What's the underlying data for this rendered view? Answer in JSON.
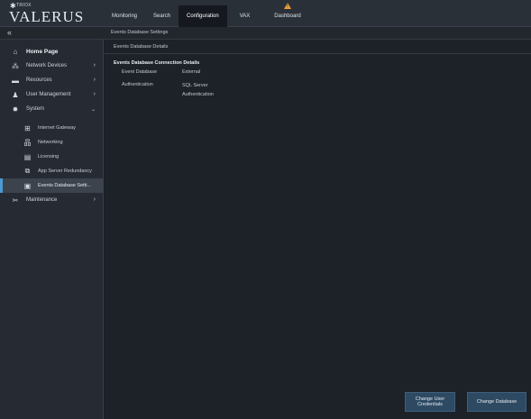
{
  "header": {
    "brand_small": "TRIOX",
    "brand": "VALERUS",
    "nav": [
      {
        "label": "Monitoring",
        "active": false
      },
      {
        "label": "Search",
        "active": false
      },
      {
        "label": "Configuration",
        "active": true
      },
      {
        "label": "VAX",
        "active": false
      },
      {
        "label": "Dashboard",
        "active": false,
        "icon": "warning-icon"
      }
    ]
  },
  "subbar": {
    "collapse_icon": "«",
    "breadcrumb": "Events Database Settings"
  },
  "sidebar": {
    "items": [
      {
        "label": "Home Page",
        "icon": "home-icon"
      },
      {
        "label": "Network Devices",
        "icon": "network-devices-icon"
      },
      {
        "label": "Resources",
        "icon": "resources-icon"
      },
      {
        "label": "User Management",
        "icon": "user-management-icon"
      },
      {
        "label": "System",
        "icon": "gear-icon"
      },
      {
        "label": "Maintenance",
        "icon": "tools-icon"
      }
    ],
    "system_children": [
      {
        "label": "Internet Gateway",
        "icon": "gateway-icon"
      },
      {
        "label": "Networking",
        "icon": "networking-icon"
      },
      {
        "label": "Licensing",
        "icon": "license-icon"
      },
      {
        "label": "App Server Redundancy",
        "icon": "redundancy-icon"
      },
      {
        "label": "Events Database Setti...",
        "icon": "database-settings-icon",
        "active": true
      }
    ]
  },
  "main": {
    "panel_title": "Events Database Details",
    "section_title": "Events Database Connection Details",
    "rows": [
      {
        "label": "Event Database",
        "value": "External"
      },
      {
        "label": "Authentication",
        "value": "SQL Server Authentication"
      }
    ],
    "buttons": {
      "change_credentials": "Change User Credentials",
      "change_database": "Change Database"
    }
  },
  "colors": {
    "accent": "#4a9bd6",
    "warning": "#e8a13a",
    "button_bg": "#2e4a63"
  }
}
